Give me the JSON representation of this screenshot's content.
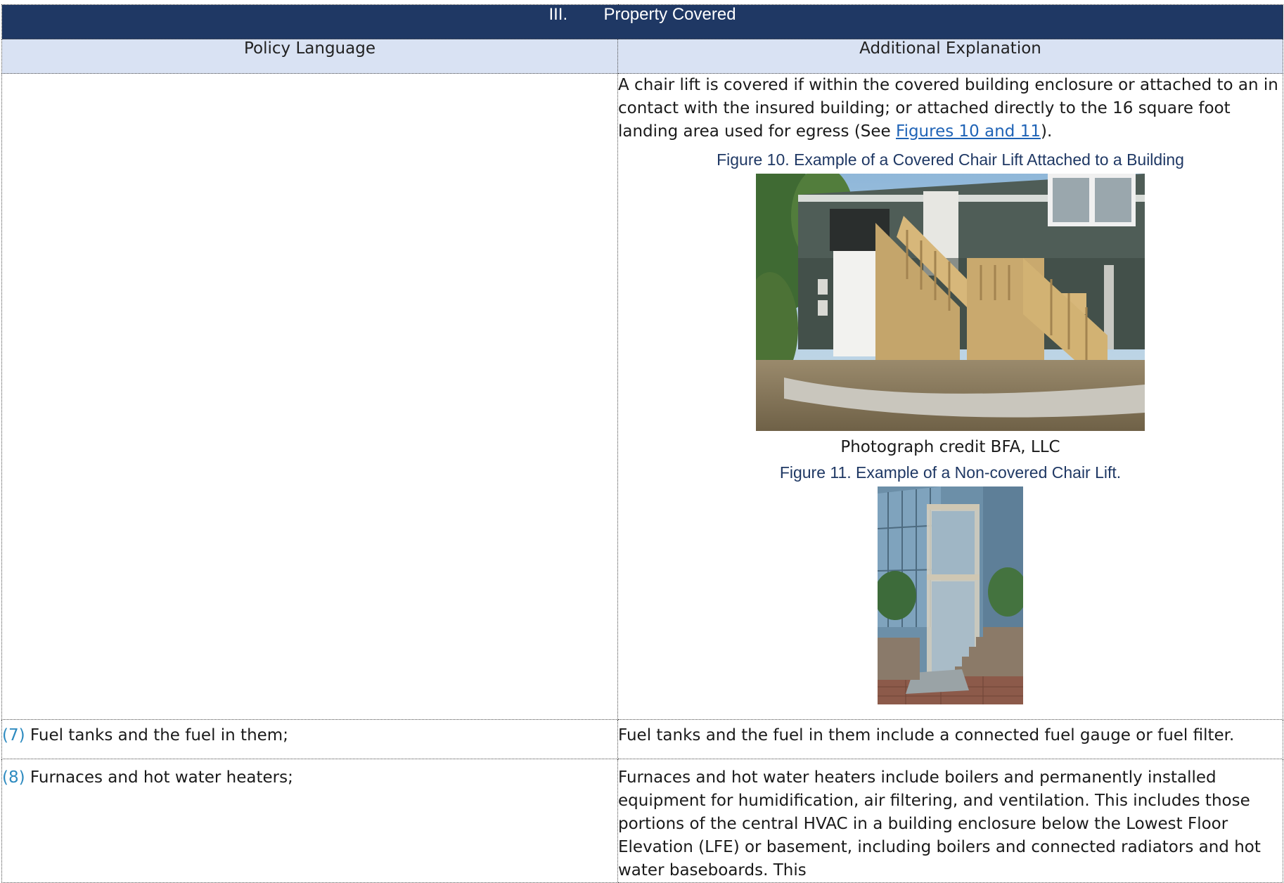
{
  "section": {
    "number": "III.",
    "title": "Property Covered"
  },
  "columns": {
    "left": "Policy Language",
    "right": "Additional Explanation"
  },
  "rows": {
    "chair_lift": {
      "text_before_link": "A chair lift is covered if within the covered building enclosure or attached to an in contact with the insured building; or attached directly to the 16 square foot landing area used for egress (See ",
      "link": "Figures 10 and 11",
      "text_after_link": ").",
      "figure10_title": "Figure 10. Example of a Covered Chair Lift Attached to a Building",
      "photo_credit": "Photograph credit BFA, LLC",
      "figure11_title": "Figure 11. Example of a Non-covered Chair Lift."
    },
    "fuel": {
      "num": "(7)",
      "policy": "Fuel tanks and the fuel in them;",
      "explanation": "Fuel tanks and the fuel in them include a connected fuel gauge or fuel filter."
    },
    "furnace": {
      "num": "(8)",
      "policy": "Furnaces and hot water heaters;",
      "explanation": "Furnaces and hot water heaters include boilers and permanently installed equipment for humidification, air filtering, and ventilation. This includes those portions of the central HVAC in a building enclosure below the Lowest Floor Elevation (LFE) or basement, including boilers and connected radiators and hot water baseboards. This"
    }
  }
}
